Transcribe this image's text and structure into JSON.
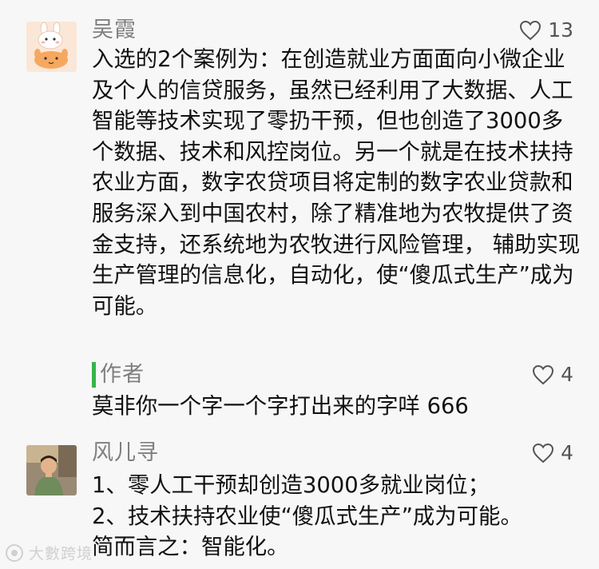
{
  "comments": [
    {
      "nickname": "吴霞",
      "likes": "13",
      "text": "入选的2个案例为：在创造就业方面面向小微企业及个人的信贷服务，虽然已经利用了大数据、人工智能等技术实现了零扔干预，但也创造了3000多个数据、技术和风控岗位。另一个就是在技术扶持农业方面，数字农贷项目将定制的数字农业贷款和服务深入到中国农村，除了精准地为农牧提供了资金支持，还系统地为农牧进行风险管理， 辅助实现生产管理的信息化，自动化，使“傻瓜式生产”成为可能。",
      "avatar_icon": "cartoon-rabbit-avatar",
      "reply": {
        "author": "作者",
        "likes": "4",
        "text": "莫非你一个字一个字打出来的字咩 666"
      }
    },
    {
      "nickname": "风儿寻",
      "likes": "4",
      "text": "1、零人工干预却创造3000多就业岗位；\n2、技术扶持农业使“傻瓜式生产”成为可能。\n简而言之：智能化。",
      "avatar_icon": "person-photo-avatar"
    }
  ],
  "watermark": "大數跨境",
  "colors": {
    "reply_bar": "#38b44a",
    "background": "#f7f7f7",
    "meta_text": "#7f7f7f"
  }
}
